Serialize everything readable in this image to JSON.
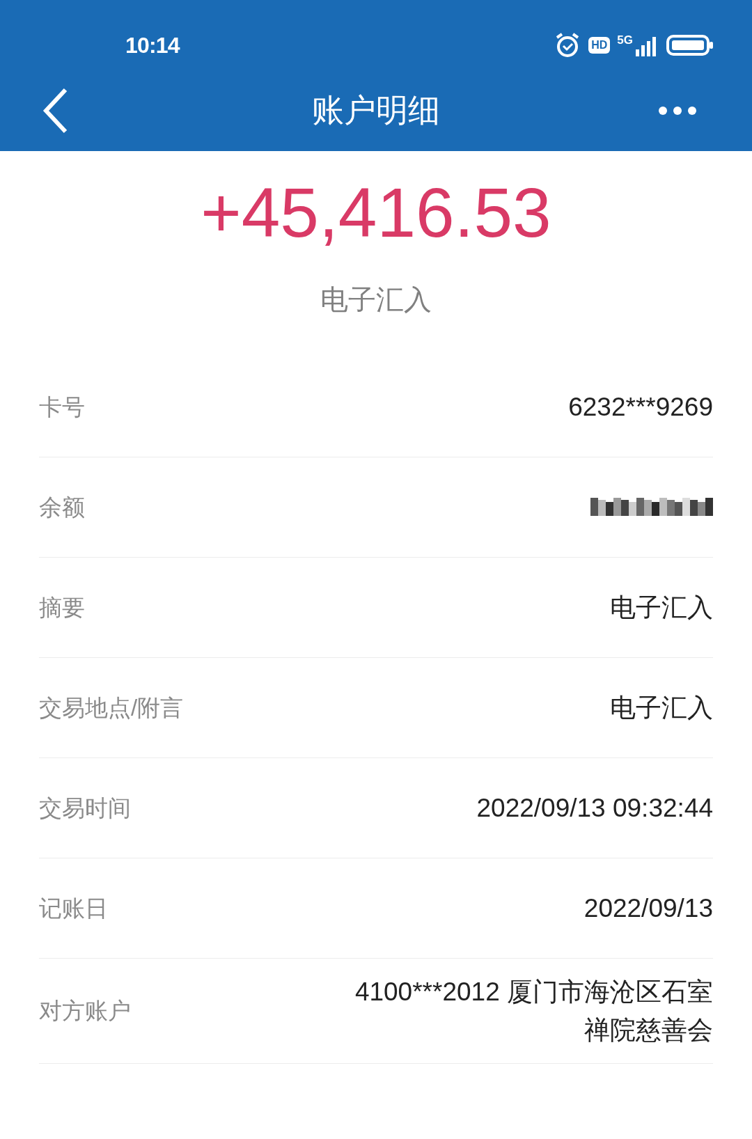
{
  "status_bar": {
    "time": "10:14",
    "network": "5G",
    "hd": "HD"
  },
  "header": {
    "title": "账户明细"
  },
  "amount": "+45,416.53",
  "subtitle": "电子汇入",
  "rows": [
    {
      "kind": "text",
      "label": "卡号",
      "value": "6232***9269"
    },
    {
      "kind": "redacted",
      "label": "余额"
    },
    {
      "kind": "text",
      "label": "摘要",
      "value": "电子汇入"
    },
    {
      "kind": "text",
      "label": "交易地点/附言",
      "value": "电子汇入"
    },
    {
      "kind": "text",
      "label": "交易时间",
      "value": "2022/09/13 09:32:44"
    },
    {
      "kind": "text",
      "label": "记账日",
      "value": "2022/09/13"
    },
    {
      "kind": "text",
      "label": "对方账户",
      "value": "4100***2012 厦门市海沧区石室禅院慈善会"
    }
  ]
}
